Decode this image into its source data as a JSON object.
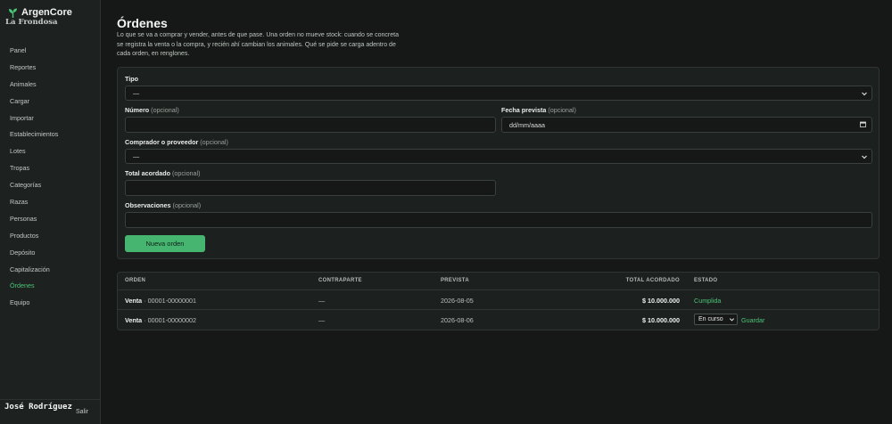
{
  "app": {
    "name": "ArgenCore",
    "farm": "La Frondosa"
  },
  "nav": [
    {
      "label": "Panel"
    },
    {
      "label": "Reportes"
    },
    {
      "label": "Animales"
    },
    {
      "label": "Cargar"
    },
    {
      "label": "Importar"
    },
    {
      "label": "Establecimientos"
    },
    {
      "label": "Lotes"
    },
    {
      "label": "Tropas"
    },
    {
      "label": "Categorías"
    },
    {
      "label": "Razas"
    },
    {
      "label": "Personas"
    },
    {
      "label": "Productos"
    },
    {
      "label": "Depósito"
    },
    {
      "label": "Capitalización"
    },
    {
      "label": "Órdenes",
      "active": true
    },
    {
      "label": "Equipo"
    }
  ],
  "user": {
    "name": "José Rodríguez",
    "logout": "Salir"
  },
  "page": {
    "title": "Órdenes",
    "intro": "Lo que se va a comprar y vender, antes de que pase. Una orden no mueve stock: cuando se concreta se registra la venta o la compra, y recién ahí cambian los animales. Qué se pide se carga adentro de cada orden, en renglones."
  },
  "form": {
    "optional": "(opcional)",
    "tipo": {
      "label": "Tipo",
      "value": "—"
    },
    "numero": {
      "label": "Número",
      "value": ""
    },
    "fecha": {
      "label": "Fecha prevista",
      "value": "dd/mm/aaaa"
    },
    "contraparte": {
      "label": "Comprador o proveedor",
      "value": "—"
    },
    "total": {
      "label": "Total acordado",
      "value": ""
    },
    "observaciones": {
      "label": "Observaciones",
      "value": ""
    },
    "submit": "Nueva orden"
  },
  "table": {
    "headers": {
      "orden": "ORDEN",
      "contraparte": "CONTRAPARTE",
      "prevista": "PREVISTA",
      "total": "TOTAL ACORDADO",
      "estado": "ESTADO"
    },
    "rows": [
      {
        "tipo": "Venta",
        "numero": "· 00001-00000001",
        "contraparte": "—",
        "prevista": "2026-08-05",
        "total": "$ 10.000.000",
        "estado": "Cumplida"
      },
      {
        "tipo": "Venta",
        "numero": "· 00001-00000002",
        "contraparte": "—",
        "prevista": "2026-08-06",
        "total": "$ 10.000.000",
        "estado": "En curso",
        "action": "Guardar"
      }
    ]
  },
  "colors": {
    "accent": "#4cc477",
    "button": "#46b56f",
    "background": "#151816",
    "sidebar": "#1d2120"
  }
}
